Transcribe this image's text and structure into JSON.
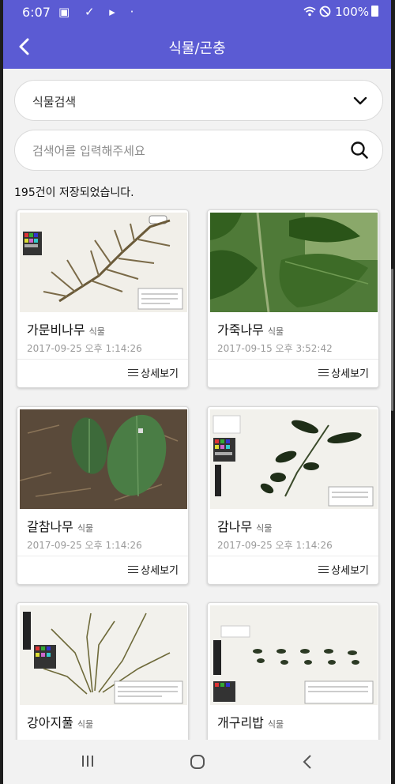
{
  "status_bar": {
    "time": "6:07",
    "left_icons": "▣ ✓ ▸ ·",
    "battery_text": "100%"
  },
  "app_bar": {
    "title": "식물/곤충",
    "back_icon": "chevron-left-icon"
  },
  "category_select": {
    "value": "식물검색",
    "icon": "chevron-down-icon"
  },
  "search": {
    "placeholder": "검색어를 입력해주세요",
    "icon": "search-icon"
  },
  "result_count": "195건이 저장되었습니다.",
  "cards": [
    {
      "name": "가문비나무",
      "category": "식물",
      "date": "2017-09-25 오후 1:14:26",
      "detail_label": "상세보기"
    },
    {
      "name": "가죽나무",
      "category": "식물",
      "date": "2017-09-15 오후 3:52:42",
      "detail_label": "상세보기"
    },
    {
      "name": "갈참나무",
      "category": "식물",
      "date": "2017-09-25 오후 1:14:26",
      "detail_label": "상세보기"
    },
    {
      "name": "감나무",
      "category": "식물",
      "date": "2017-09-25 오후 1:14:26",
      "detail_label": "상세보기"
    },
    {
      "name": "강아지풀",
      "category": "식물",
      "date": "",
      "detail_label": ""
    },
    {
      "name": "개구리밥",
      "category": "식물",
      "date": "",
      "detail_label": ""
    }
  ],
  "colors": {
    "primary": "#5b5bd3",
    "background": "#f2f2f2"
  }
}
